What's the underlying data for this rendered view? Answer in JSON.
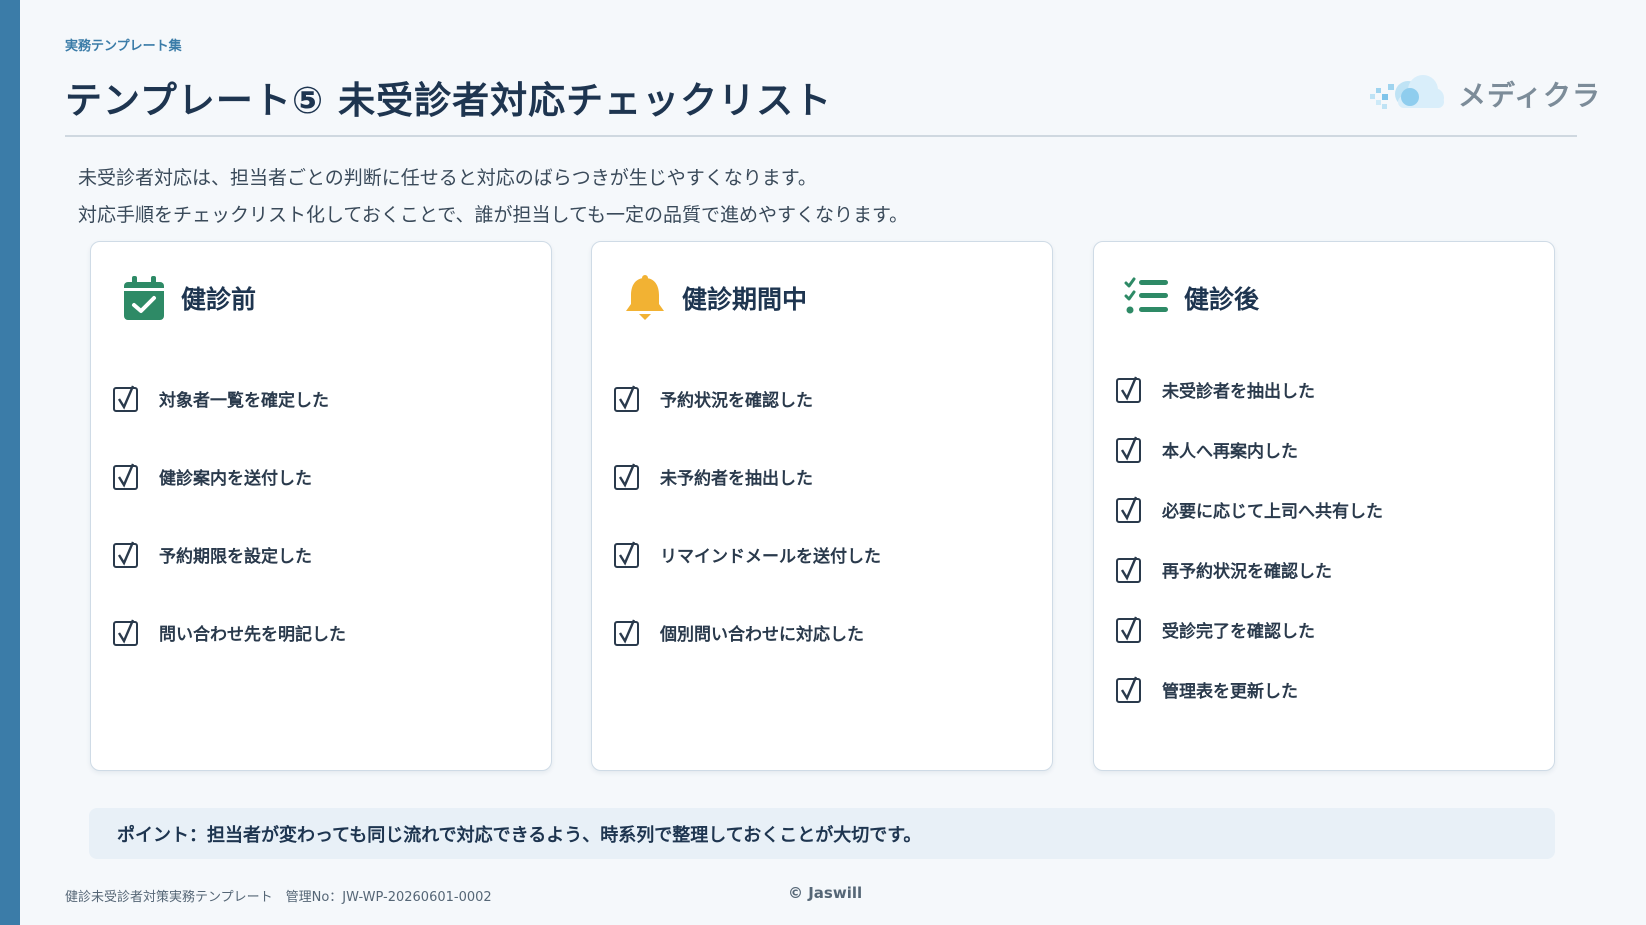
{
  "header": {
    "category": "実務テンプレート集",
    "title": "テンプレート⑤ 未受診者対応チェックリスト",
    "logo_text": "メディクラ"
  },
  "intro": {
    "line1": "未受診者対応は、担当者ごとの判断に任せると対応のばらつきが生じやすくなります。",
    "line2": "対応手順をチェックリスト化しておくことで、誰が担当しても一定の品質で進めやすくなります。"
  },
  "cards": [
    {
      "title": "健診前",
      "icon": "calendar-check-icon",
      "icon_color": "#2e8a66",
      "items": [
        "対象者一覧を確定した",
        "健診案内を送付した",
        "予約期限を設定した",
        "問い合わせ先を明記した"
      ]
    },
    {
      "title": "健診期間中",
      "icon": "bell-icon",
      "icon_color": "#f2b233",
      "items": [
        "予約状況を確認した",
        "未予約者を抽出した",
        "リマインドメールを送付した",
        "個別問い合わせに対応した"
      ]
    },
    {
      "title": "健診後",
      "icon": "checklist-icon",
      "icon_color": "#2e8a66",
      "items": [
        "未受診者を抽出した",
        "本人へ再案内した",
        "必要に応じて上司へ共有した",
        "再予約状況を確認した",
        "受診完了を確認した",
        "管理表を更新した"
      ]
    }
  ],
  "point": "ポイント：担当者が変わっても同じ流れで対応できるよう、時系列で整理しておくことが大切です。",
  "footer": {
    "left": "健診未受診者対策実務テンプレート　管理No：JW-WP-20260601-0002",
    "center": "© Jaswill"
  },
  "colors": {
    "accent_bar": "#3b7ca8",
    "title": "#1e3550",
    "point_bg": "#e8f0f7"
  }
}
